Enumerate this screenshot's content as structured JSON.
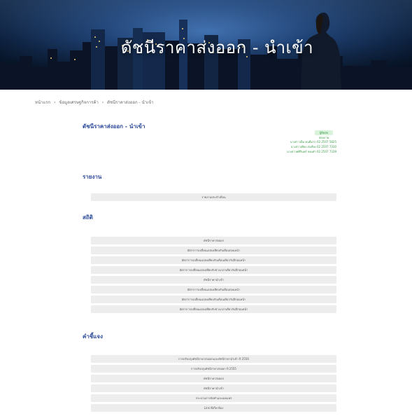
{
  "hero": {
    "title": "ดัชนีราคาส่งออก - นำเข้า"
  },
  "breadcrumb": [
    "หน้าแรก",
    "ข้อมูลเศรษฐกิจการค้า",
    "ดัชนีราคาส่งออก - นำเข้า"
  ],
  "breadcrumb_separator": "›",
  "page": {
    "heading": "ดัชนีราคาส่งออก - นำเข้า",
    "tag": "ผู้ติดต่อสอบถาม"
  },
  "contacts": [
    "นางสาวเอ็ม คนดีมาก 02 2507 5825",
    "นางสาวเพียง ส่งเสียง 02 2507 7330",
    "นางสาวศศิรินทร์ ทองคำ 02 2507 7339"
  ],
  "sections": {
    "report": {
      "title": "รายงาน",
      "items": [
        "รายงานประจำเดือน"
      ]
    },
    "stats": {
      "title": "สถิติ",
      "items": [
        "ดัชนีราคาส่งออก",
        "อัตราการเปลี่ยนแปลงเทียบกับเดือนก่อนหน้า",
        "อัตราการเปลี่ยนแปลงเทียบกับเดือนเดียวกันปีก่อนหน้า",
        "อัตราการเปลี่ยนแปลงเทียบกับช่วงเวลาเดียวกันปีก่อนหน้า",
        "ดัชนีราคานำเข้า",
        "อัตราการเปลี่ยนแปลงเทียบกับเดือนก่อนหน้า",
        "อัตราการเปลี่ยนแปลงเทียบกับเดือนเดียวกันปีก่อนหน้า",
        "อัตราการเปลี่ยนแปลงเทียบกับช่วงเวลาเดียวกันปีก่อนหน้า"
      ]
    },
    "explain": {
      "title": "คำชี้แจง",
      "items": [
        "การปรับปรุงดัชนีราคาส่งออกและดัชนีราคานำเข้า ปี 2556",
        "การปรับปรุงดัชนีราคาส่งออก ปี 2555",
        "ดัชนีราคาส่งออก",
        "ดัชนีราคานำเข้า",
        "กระบวนการจัดทำและเผยแพร่",
        "Link ที่เกี่ยวข้อง"
      ]
    }
  }
}
